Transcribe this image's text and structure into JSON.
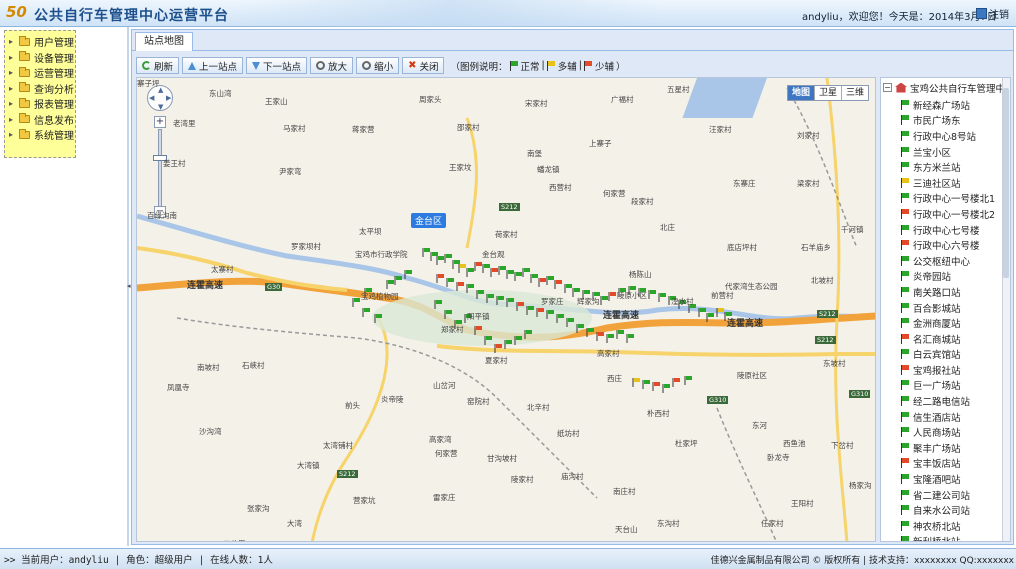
{
  "header": {
    "logo_text": "50",
    "title": "公共自行车管理中心运营平台",
    "user_info": "andyliu，欢迎您！今天是：2014年3月7日",
    "logout_label": "注销"
  },
  "nav": {
    "items": [
      {
        "label": "用户管理"
      },
      {
        "label": "设备管理"
      },
      {
        "label": "运营管理"
      },
      {
        "label": "查询分析"
      },
      {
        "label": "报表管理"
      },
      {
        "label": "信息发布"
      },
      {
        "label": "系统管理"
      }
    ]
  },
  "tabs": [
    {
      "label": "站点地图"
    }
  ],
  "toolbar": {
    "refresh": "刷新",
    "prev_station": "上一站点",
    "next_station": "下一站点",
    "zoom_in": "放大",
    "zoom_out": "缩小",
    "close": "关闭",
    "legend_prefix": "（图例说明：",
    "legend_normal": "正常",
    "legend_sep1": "|",
    "legend_many": "多辅",
    "legend_sep2": "|",
    "legend_few": "少辅",
    "legend_suffix": "）"
  },
  "legend_colors": {
    "normal": "#2aa62a",
    "many": "#e7c21a",
    "few": "#e34a2a"
  },
  "map": {
    "type_buttons": [
      "地图",
      "卫星",
      "三维"
    ],
    "active_type": "地图",
    "district": "金台区",
    "highway_labels": [
      "连霍高速",
      "连霍高速",
      "连霍高速"
    ],
    "road_shields": [
      "G30",
      "S212",
      "S212",
      "S212",
      "G310",
      "S212",
      "G310"
    ],
    "labels": [
      "东山湾",
      "王家山",
      "周家头",
      "宋家村",
      "广福村",
      "五星村",
      "老湾里",
      "马家村",
      "蒋家营",
      "邵家村",
      "汪家村",
      "姜王村",
      "尹家弯",
      "王家坟",
      "上寨子",
      "刘家村",
      "蟠龙镇",
      "南堡",
      "何家营",
      "西营村",
      "段家村",
      "东寨庄",
      "梁家村",
      "北庄",
      "百缘沟南",
      "太平坝",
      "荷家村",
      "千河镇",
      "底店坪村",
      "石羊庙乡",
      "罗家坝村",
      "太寨村",
      "宝鸡市行政学院",
      "金台观",
      "杨陈山",
      "代家湾生态公园",
      "北坡村",
      "宝鸡植物园",
      "陵原小区",
      "阳平镇",
      "罗家庄",
      "辉家沟",
      "湟水村",
      "前营村",
      "郑家村",
      "夏家村",
      "高家村",
      "西庄",
      "陵原社区",
      "东坡村",
      "凤凰寺",
      "南坡村",
      "石峡村",
      "东河",
      "炎帝陵",
      "山岔河",
      "窑院村",
      "前头",
      "北辛村",
      "朴西村",
      "纸坊村",
      "沙沟湾",
      "高家湾",
      "杜家坪",
      "西鱼池",
      "下岔村",
      "卧龙寺",
      "大湾镇",
      "太湾铺村",
      "何家营",
      "甘沟坡村",
      "张家沟",
      "营家坑",
      "雷家庄",
      "南庄村",
      "东沟村",
      "陵家村",
      "庙沟村",
      "大湾",
      "天台山",
      "王阳村",
      "任家村",
      "二公里",
      "杨家沟",
      "寨子坪"
    ]
  },
  "tree": {
    "root": "宝鸡公共自行车管理中心",
    "stations": [
      {
        "name": "新经森广场站",
        "status": "normal"
      },
      {
        "name": "市民广场东",
        "status": "normal"
      },
      {
        "name": "行政中心8号站",
        "status": "normal"
      },
      {
        "name": "兰宝小区",
        "status": "normal"
      },
      {
        "name": "东方米兰站",
        "status": "normal"
      },
      {
        "name": "三迪社区站",
        "status": "many"
      },
      {
        "name": "行政中心一号楼北1",
        "status": "normal"
      },
      {
        "name": "行政中心一号楼北2",
        "status": "few"
      },
      {
        "name": "行政中心七号楼",
        "status": "normal"
      },
      {
        "name": "行政中心六号楼",
        "status": "few"
      },
      {
        "name": "公交枢纽中心",
        "status": "normal"
      },
      {
        "name": "炎帝园站",
        "status": "normal"
      },
      {
        "name": "南关路口站",
        "status": "normal"
      },
      {
        "name": "百合影城站",
        "status": "normal"
      },
      {
        "name": "金洲商厦站",
        "status": "normal"
      },
      {
        "name": "名汇商城站",
        "status": "few"
      },
      {
        "name": "白云宾馆站",
        "status": "normal"
      },
      {
        "name": "宝鸡报社站",
        "status": "few"
      },
      {
        "name": "巨一广场站",
        "status": "normal"
      },
      {
        "name": "经二路电信站",
        "status": "normal"
      },
      {
        "name": "信生酒店站",
        "status": "normal"
      },
      {
        "name": "人民商场站",
        "status": "normal"
      },
      {
        "name": "聚丰广场站",
        "status": "normal"
      },
      {
        "name": "宝丰饭店站",
        "status": "few"
      },
      {
        "name": "宝隆酒吧站",
        "status": "normal"
      },
      {
        "name": "省二建公司站",
        "status": "normal"
      },
      {
        "name": "自来水公司站",
        "status": "normal"
      },
      {
        "name": "神农桥北站",
        "status": "normal"
      },
      {
        "name": "新利桥北站",
        "status": "normal"
      }
    ]
  },
  "status_bar": {
    "current_user": ">> 当前用户：andyliu",
    "role": "| 角色：超级用户",
    "online": "| 在线人数：1人",
    "company": "佳德兴金属制品有限公司 © 版权所有 | 技术支持：xxxxxxxx QQ:xxxxxxx"
  }
}
